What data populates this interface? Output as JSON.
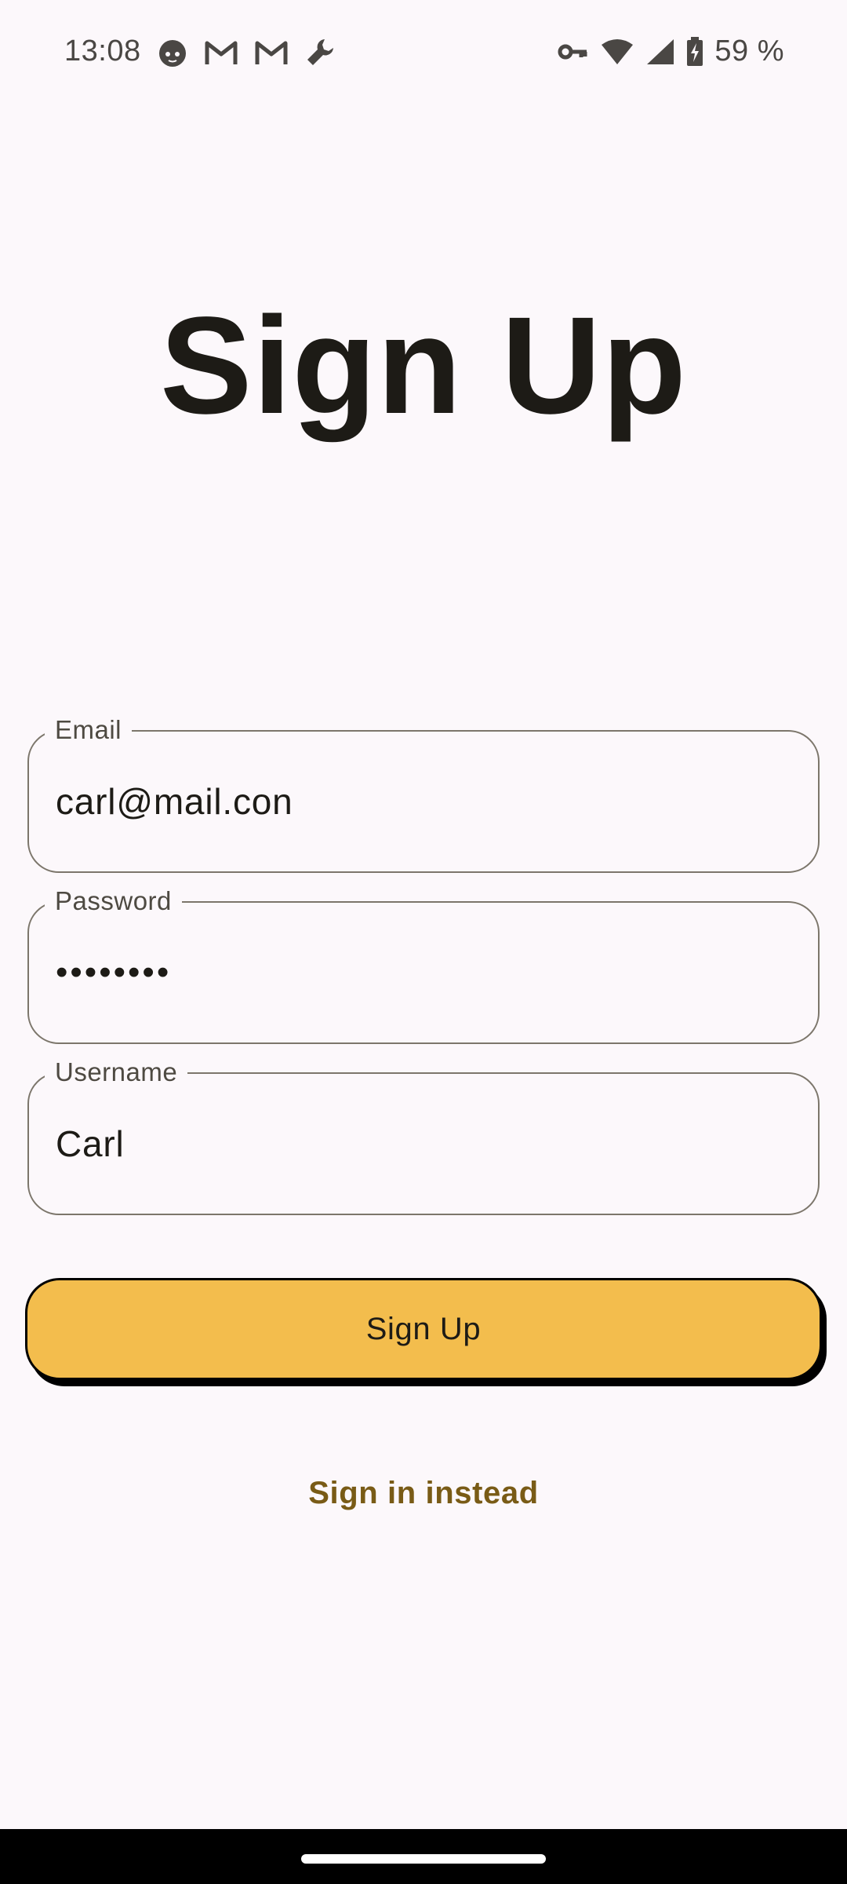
{
  "status_bar": {
    "time": "13:08",
    "left_icons": [
      "cat-face-icon",
      "gmail-icon",
      "gmail-icon",
      "wrench-icon"
    ],
    "right_icons": [
      "vpn-key-icon",
      "wifi-icon",
      "cell-signal-icon",
      "battery-charging-icon"
    ],
    "battery_text": "59 %"
  },
  "title": "Sign Up",
  "form": {
    "email": {
      "label": "Email",
      "value": "carl@mail.con"
    },
    "password": {
      "label": "Password",
      "value": "••••••••"
    },
    "username": {
      "label": "Username",
      "value": "Carl"
    }
  },
  "primary_button": {
    "label": "Sign Up",
    "color": "#f3bd4d"
  },
  "secondary_link": {
    "label": "Sign in instead",
    "color": "#795b16"
  },
  "colors": {
    "background": "#fcf8fb",
    "outline": "#7c766b",
    "text": "#1d1b16"
  }
}
